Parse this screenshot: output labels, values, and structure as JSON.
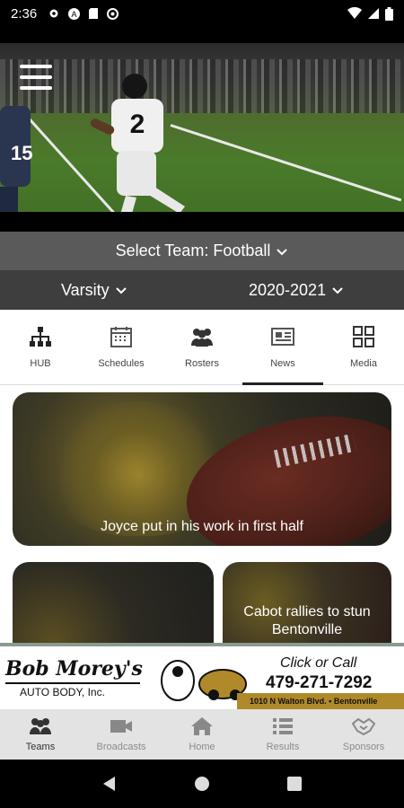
{
  "status_bar": {
    "time": "2:36",
    "icons": [
      "settings-icon",
      "a-icon",
      "sd-icon",
      "data-saver-icon"
    ],
    "right_icons": [
      "wifi-icon",
      "signal-icon",
      "battery-icon"
    ]
  },
  "hero": {
    "player_number": "2",
    "jersey_left": "15"
  },
  "team_selector": {
    "label": "Select Team:",
    "value": "Football"
  },
  "level_selector": {
    "value": "Varsity"
  },
  "season_selector": {
    "value": "2020-2021"
  },
  "tabs": [
    {
      "label": "HUB",
      "icon": "hub-icon"
    },
    {
      "label": "Schedules",
      "icon": "calendar-icon"
    },
    {
      "label": "Rosters",
      "icon": "people-icon"
    },
    {
      "label": "News",
      "icon": "news-icon"
    },
    {
      "label": "Media",
      "icon": "grid-icon"
    }
  ],
  "active_tab": "News",
  "news": [
    {
      "title": "Joyce put in his work in first half"
    },
    {
      "title": ""
    },
    {
      "title": "Cabot rallies to stun Bentonville"
    }
  ],
  "ad": {
    "name": "Bob Morey's",
    "sub": "AUTO BODY, Inc.",
    "click": "Click or Call",
    "phone": "479-271-7292",
    "address": "1010 N Walton Blvd. • Bentonville"
  },
  "bottom_nav": [
    {
      "label": "Teams",
      "icon": "teams-icon"
    },
    {
      "label": "Broadcasts",
      "icon": "video-camera-icon"
    },
    {
      "label": "Home",
      "icon": "home-icon"
    },
    {
      "label": "Results",
      "icon": "list-icon"
    },
    {
      "label": "Sponsors",
      "icon": "handshake-icon"
    }
  ],
  "active_bottom": "Teams",
  "colors": {
    "team_bar": "#5a5a5a",
    "level_bar": "#3e3e3e",
    "ad_gold": "#b08a2a"
  }
}
